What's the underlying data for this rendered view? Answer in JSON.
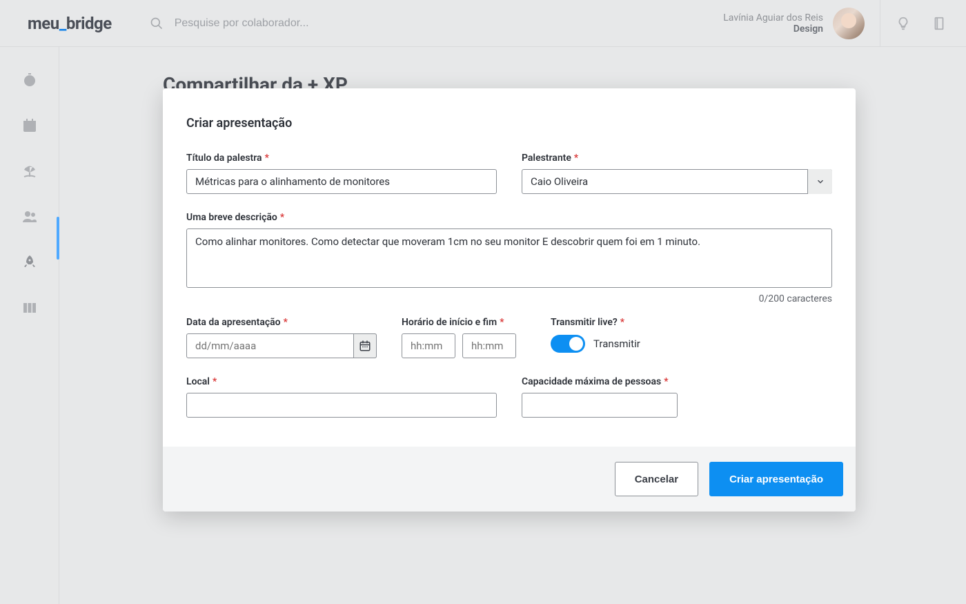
{
  "app": {
    "logo_prefix": "meu",
    "logo_underscore": "_",
    "logo_suffix": "bridge"
  },
  "header": {
    "search_placeholder": "Pesquise por colaborador...",
    "user_name": "Lavínia Aguiar dos Reis",
    "user_role": "Design"
  },
  "page": {
    "title": "Compartilhar da + XP"
  },
  "modal": {
    "title": "Criar apresentação",
    "fields": {
      "titulo": {
        "label": "Título da palestra",
        "value": "Métricas para o alinhamento de monitores"
      },
      "palestrante": {
        "label": "Palestrante",
        "value": "Caio Oliveira"
      },
      "descricao": {
        "label": "Uma breve descrição",
        "value": "Como alinhar monitores. Como detectar que moveram 1cm no seu monitor E descobrir quem foi em 1 minuto.",
        "char_count": "0/200 caracteres"
      },
      "data": {
        "label": "Data da apresentação",
        "placeholder": "dd/mm/aaaa"
      },
      "horario": {
        "label": "Horário de início e fim",
        "start_placeholder": "hh:mm",
        "end_placeholder": "hh:mm"
      },
      "live": {
        "label": "Transmitir live?",
        "toggle_label": "Transmitir",
        "value": true
      },
      "local": {
        "label": "Local",
        "value": ""
      },
      "capacidade": {
        "label": "Capacidade máxima de pessoas",
        "value": ""
      }
    },
    "buttons": {
      "cancel": "Cancelar",
      "submit": "Criar apresentação"
    }
  }
}
